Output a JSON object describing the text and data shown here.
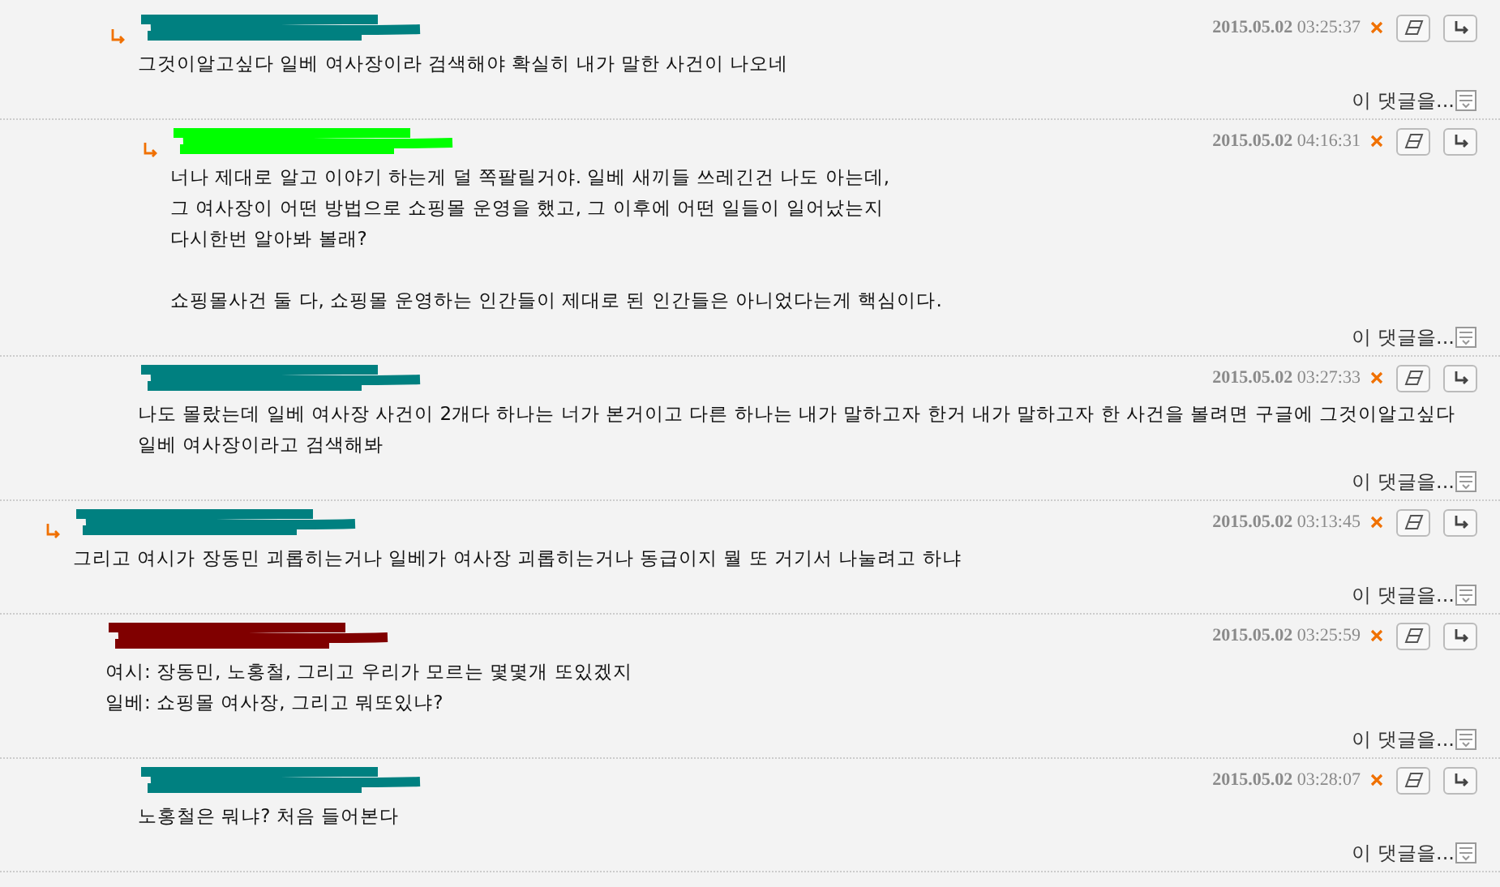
{
  "thread": [
    {
      "children": [
        {
          "children": [
            {
              "reply_arrow": true,
              "color": "#008080",
              "date": "2015.05.02",
              "time": "03:25:37",
              "text": "그것이알고싶다 일베 여사장이라 검색해야 확실히 내가 말한 사건이 나오네",
              "more": "이 댓글을...",
              "children": [
                {
                  "reply_arrow": true,
                  "color": "#00ff00",
                  "date": "2015.05.02",
                  "time": "04:16:31",
                  "text": "너나 제대로 알고 이야기 하는게 덜 쪽팔릴거야. 일베 새끼들 쓰레긴건 나도 아는데,\n그 여사장이 어떤 방법으로 쇼핑몰 운영을 했고, 그 이후에 어떤 일들이 일어났는지\n다시한번 알아봐 볼래?\n\n쇼핑몰사건 둘 다, 쇼핑몰 운영하는 인간들이 제대로 된 인간들은 아니었다는게 핵심이다.",
                  "more": "이 댓글을..."
                }
              ]
            },
            {
              "reply_arrow": false,
              "color": "#008080",
              "date": "2015.05.02",
              "time": "03:27:33",
              "text": "나도 몰랐는데 일베 여사장 사건이 2개다 하나는 너가 본거이고 다른 하나는 내가 말하고자 한거 내가 말하고자 한 사건을 볼려면 구글에 그것이알고싶다\n일베 여사장이라고 검색해봐",
              "more": "이 댓글을..."
            }
          ]
        }
      ]
    },
    {
      "reply_arrow": true,
      "color": "#008080",
      "date": "2015.05.02",
      "time": "03:13:45",
      "text": "그리고 여시가 장동민 괴롭히는거나 일베가 여사장 괴롭히는거나 동급이지 뭘 또 거기서 나눌려고 하냐",
      "more": "이 댓글을...",
      "children": [
        {
          "reply_arrow": false,
          "color": "#800000",
          "date": "2015.05.02",
          "time": "03:25:59",
          "text": "여시: 장동민, 노홍철, 그리고 우리가 모르는 몇몇개 또있겠지\n일베: 쇼핑몰 여사장, 그리고 뭐또있냐?",
          "more": "이 댓글을...",
          "children": [
            {
              "reply_arrow": false,
              "color": "#008080",
              "date": "2015.05.02",
              "time": "03:28:07",
              "text": "노홍철은 뭐냐? 처음 들어본다",
              "more": "이 댓글을..."
            }
          ]
        }
      ]
    }
  ]
}
